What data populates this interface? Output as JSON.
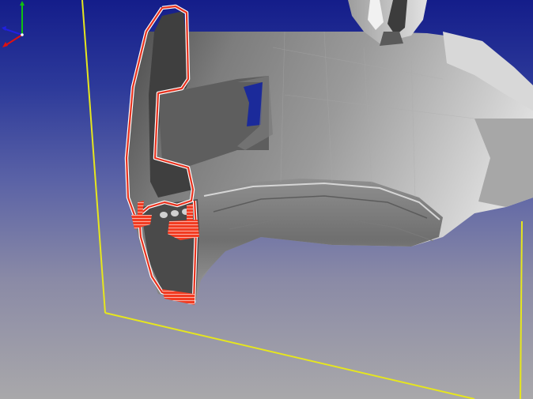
{
  "viewer": {
    "scene": "section-cut",
    "background_top": "#141d8a",
    "background_bottom": "#a9a8aa"
  },
  "part": {
    "surface_color": "#8a8a8a",
    "surface_highlight": "#cfcfcf",
    "surface_shadow": "#3a3a3a",
    "section_outline_color": "#e8321e",
    "section_hatch_color": "#ff4a2a"
  },
  "section_plane": {
    "frame_color": "#e6e61e"
  },
  "triad": {
    "x_axis_color": "#e01010",
    "y_axis_color": "#10c010",
    "z_axis_color": "#2020e0",
    "icon": "axis-triad-icon"
  }
}
